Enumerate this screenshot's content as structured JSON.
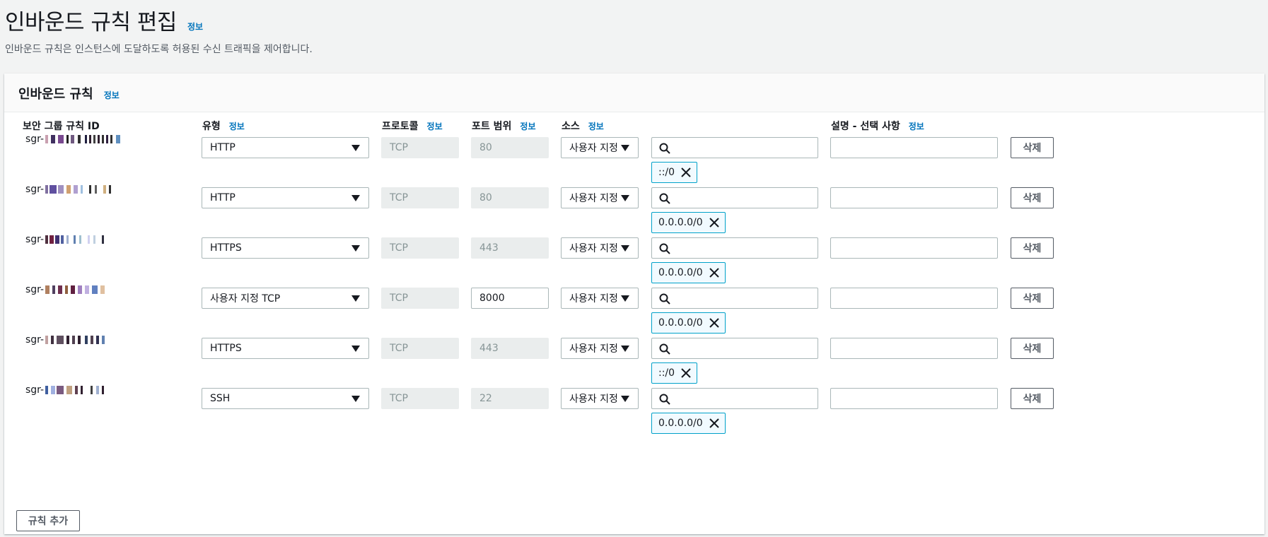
{
  "page": {
    "title": "인바운드 규칙 편집",
    "info": "정보",
    "description": "인바운드 규칙은 인스턴스에 도달하도록 허용된 수신 트래픽을 제어합니다."
  },
  "panel": {
    "title": "인바운드 규칙",
    "info": "정보"
  },
  "columns": {
    "rule_id": "보안 그룹 규칙 ID",
    "type": "유형",
    "protocol": "프로토콜",
    "port_range": "포트 범위",
    "source": "소스",
    "description": "설명 - 선택 사항",
    "info": "정보"
  },
  "rules": [
    {
      "id_prefix": "sgr-",
      "type": "HTTP",
      "protocol": "TCP",
      "port": "80",
      "port_editable": false,
      "source_type": "사용자 지정",
      "source_value": "",
      "cidr": "::/0",
      "description": "",
      "delete": "삭제"
    },
    {
      "id_prefix": "sgr-",
      "type": "HTTP",
      "protocol": "TCP",
      "port": "80",
      "port_editable": false,
      "source_type": "사용자 지정",
      "source_value": "",
      "cidr": "0.0.0.0/0",
      "description": "",
      "delete": "삭제"
    },
    {
      "id_prefix": "sgr-",
      "type": "HTTPS",
      "protocol": "TCP",
      "port": "443",
      "port_editable": false,
      "source_type": "사용자 지정",
      "source_value": "",
      "cidr": "0.0.0.0/0",
      "description": "",
      "delete": "삭제"
    },
    {
      "id_prefix": "sgr-",
      "type": "사용자 지정 TCP",
      "protocol": "TCP",
      "port": "8000",
      "port_editable": true,
      "source_type": "사용자 지정",
      "source_value": "",
      "cidr": "0.0.0.0/0",
      "description": "",
      "delete": "삭제"
    },
    {
      "id_prefix": "sgr-",
      "type": "HTTPS",
      "protocol": "TCP",
      "port": "443",
      "port_editable": false,
      "source_type": "사용자 지정",
      "source_value": "",
      "cidr": "::/0",
      "description": "",
      "delete": "삭제"
    },
    {
      "id_prefix": "sgr-",
      "type": "SSH",
      "protocol": "TCP",
      "port": "22",
      "port_editable": false,
      "source_type": "사용자 지정",
      "source_value": "",
      "cidr": "0.0.0.0/0",
      "description": "",
      "delete": "삭제"
    }
  ],
  "add_rule": "규칙 추가",
  "colors": {
    "link": "#0073bb",
    "token_border": "#00a1c9",
    "token_bg": "#f1faff",
    "disabled_bg": "#eaeded",
    "page_bg": "#f2f3f3"
  }
}
